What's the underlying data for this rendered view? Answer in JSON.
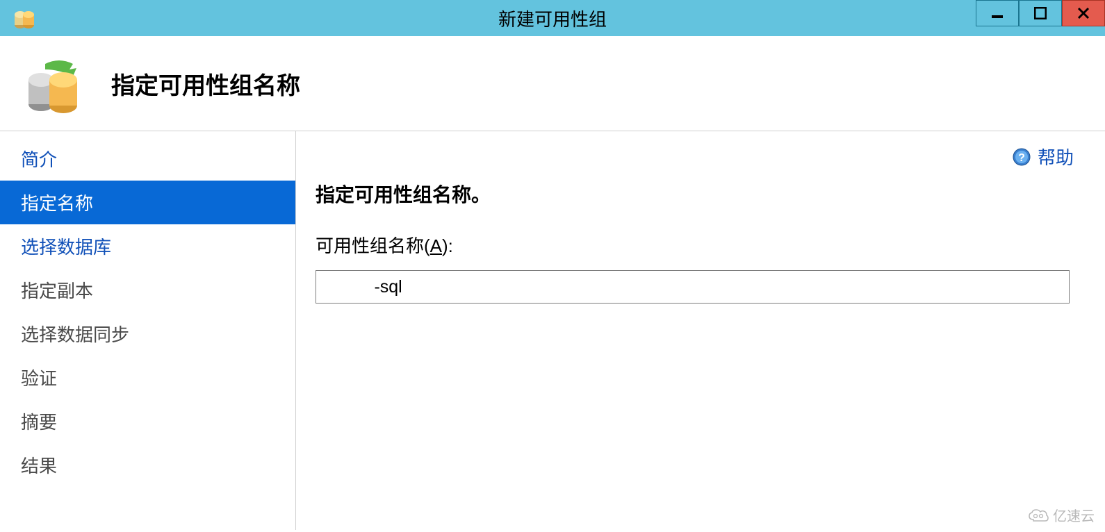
{
  "window": {
    "title": "新建可用性组"
  },
  "header": {
    "page_title": "指定可用性组名称"
  },
  "sidebar": {
    "items": [
      {
        "label": "简介",
        "state": "completed"
      },
      {
        "label": "指定名称",
        "state": "active"
      },
      {
        "label": "选择数据库",
        "state": "next"
      },
      {
        "label": "指定副本",
        "state": "pending"
      },
      {
        "label": "选择数据同步",
        "state": "pending"
      },
      {
        "label": "验证",
        "state": "pending"
      },
      {
        "label": "摘要",
        "state": "pending"
      },
      {
        "label": "结果",
        "state": "pending"
      }
    ]
  },
  "content": {
    "help_label": "帮助",
    "heading": "指定可用性组名称。",
    "field_label_prefix": "可用性组名称(",
    "field_label_accesskey": "A",
    "field_label_suffix": "):",
    "input_value": "          -sql"
  },
  "watermark": {
    "text": "亿速云"
  }
}
